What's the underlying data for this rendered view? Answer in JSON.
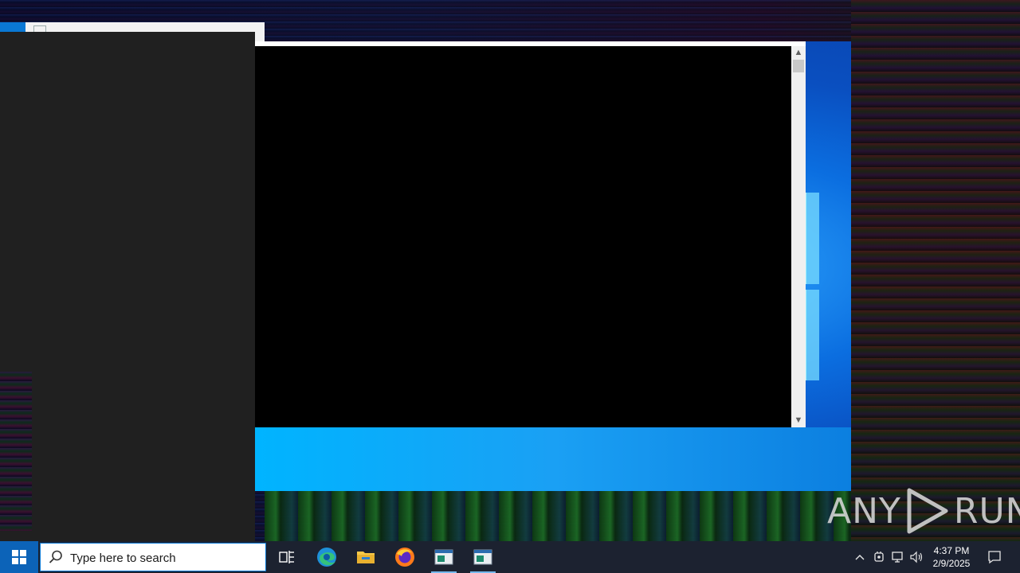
{
  "taskbar": {
    "search_placeholder": "Type here to search",
    "clock_time": "4:37 PM",
    "clock_date": "2/9/2025"
  },
  "watermark": {
    "left": "ANY",
    "right": "RUN"
  },
  "icons": {
    "start": "windows-logo-icon",
    "search": "search-icon",
    "task_view": "task-view-icon",
    "edge": "edge-icon",
    "explorer": "file-explorer-icon",
    "firefox": "firefox-icon",
    "app1": "app-window-icon",
    "app2": "app-window-icon"
  },
  "colors": {
    "taskbar": "#1c2230",
    "accent": "#0a78d4"
  }
}
